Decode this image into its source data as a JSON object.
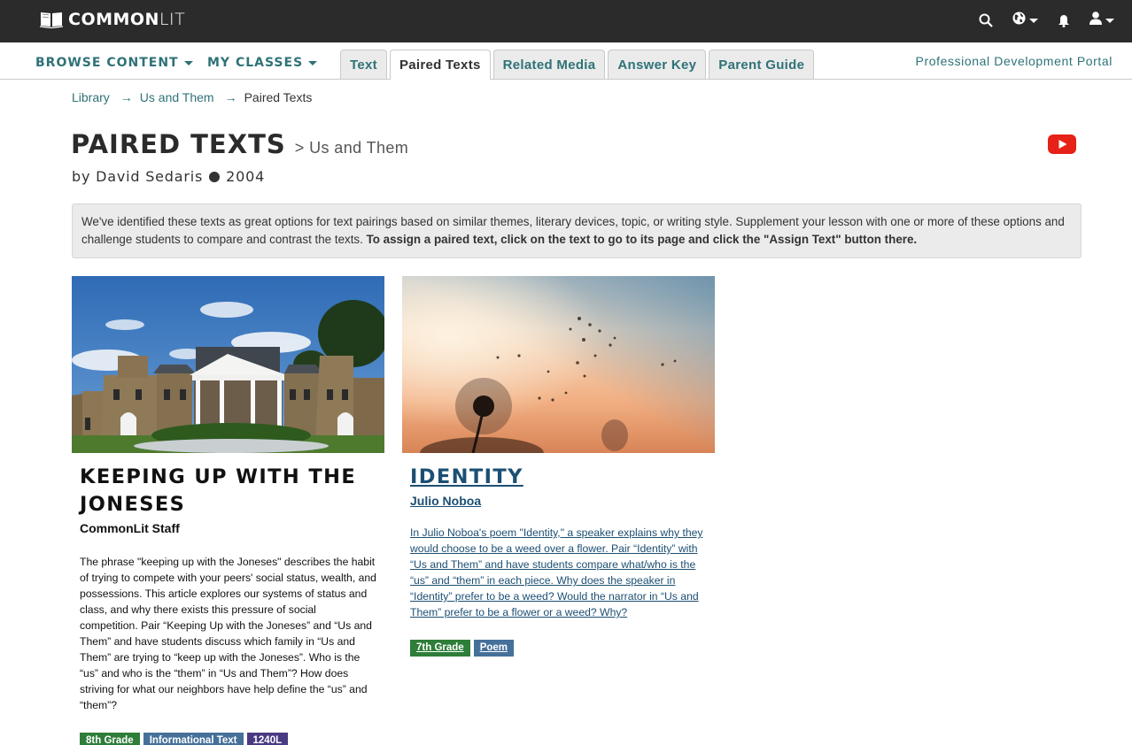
{
  "topbar": {
    "logo": {
      "bold": "COMMON",
      "light": "LIT",
      "icon": "open-book-icon"
    },
    "icons": [
      "search-icon",
      "globe-icon",
      "bell-icon",
      "user-icon"
    ]
  },
  "navbar": {
    "browse_content": "BROWSE CONTENT",
    "my_classes": "MY CLASSES",
    "tabs": [
      {
        "label": "Text",
        "active": false
      },
      {
        "label": "Paired Texts",
        "active": true
      },
      {
        "label": "Related Media",
        "active": false
      },
      {
        "label": "Answer Key",
        "active": false
      },
      {
        "label": "Parent Guide",
        "active": false
      }
    ],
    "pd_portal": "Professional Development Portal"
  },
  "breadcrumb": {
    "items": [
      "Library",
      "Us and Them"
    ],
    "current": "Paired Texts",
    "separator": "→"
  },
  "header": {
    "title": "PAIRED TEXTS",
    "subtitle": "> Us and Them",
    "author": "by David Sedaris",
    "year": "2004",
    "video_icon": "youtube-icon"
  },
  "info": {
    "text": "We've identified these texts as great options for text pairings based on similar themes, literary devices, topic, or writing style. Supplement your lesson with one or more of these options and challenge students to compare and contrast the texts. ",
    "bold": "To assign a paired text, click on the text to go to its page and click the \"Assign Text\" button there."
  },
  "cards": [
    {
      "title": "KEEPING UP WITH THE JONESES",
      "author": "CommonLit Staff",
      "image": "mansion-photo",
      "description": "The phrase \"keeping up with the Joneses\" describes the habit of trying to compete with your peers' social status, wealth, and possessions. This article explores our systems of status and class, and why there exists this pressure of social competition. Pair “Keeping Up with the Joneses” and “Us and Them” and have students discuss which family in “Us and Them” are trying to “keep up with the Joneses”. Who is the “us” and who is the “them” in “Us and Them”? How does striving for what our neighbors have help define the “us” and “them”?",
      "tags": [
        {
          "label": "8th Grade",
          "color": "#2e7d39"
        },
        {
          "label": "Informational Text",
          "color": "#457099"
        },
        {
          "label": "1240L",
          "color": "#4a3a82"
        }
      ]
    },
    {
      "title": "IDENTITY",
      "author": "Julio Noboa",
      "image": "dandelion-photo",
      "description": "In Julio Noboa's poem \"Identity,\" a speaker explains why they would choose to be a weed over a flower. Pair “Identity” with “Us and Them” and have students compare what/who is the “us” and “them” in each piece. Why does the speaker in “Identity” prefer to be a weed? Would the narrator in “Us and Them” prefer to be a flower or a weed? Why?",
      "tags": [
        {
          "label": "7th Grade",
          "color": "#2e7d39"
        },
        {
          "label": "Poem",
          "color": "#457099"
        }
      ]
    }
  ],
  "colors": {
    "topbar": "#2b2b2b",
    "teal": "#2f7277",
    "link_blue": "#1c4f73",
    "youtube_red": "#e62117"
  }
}
